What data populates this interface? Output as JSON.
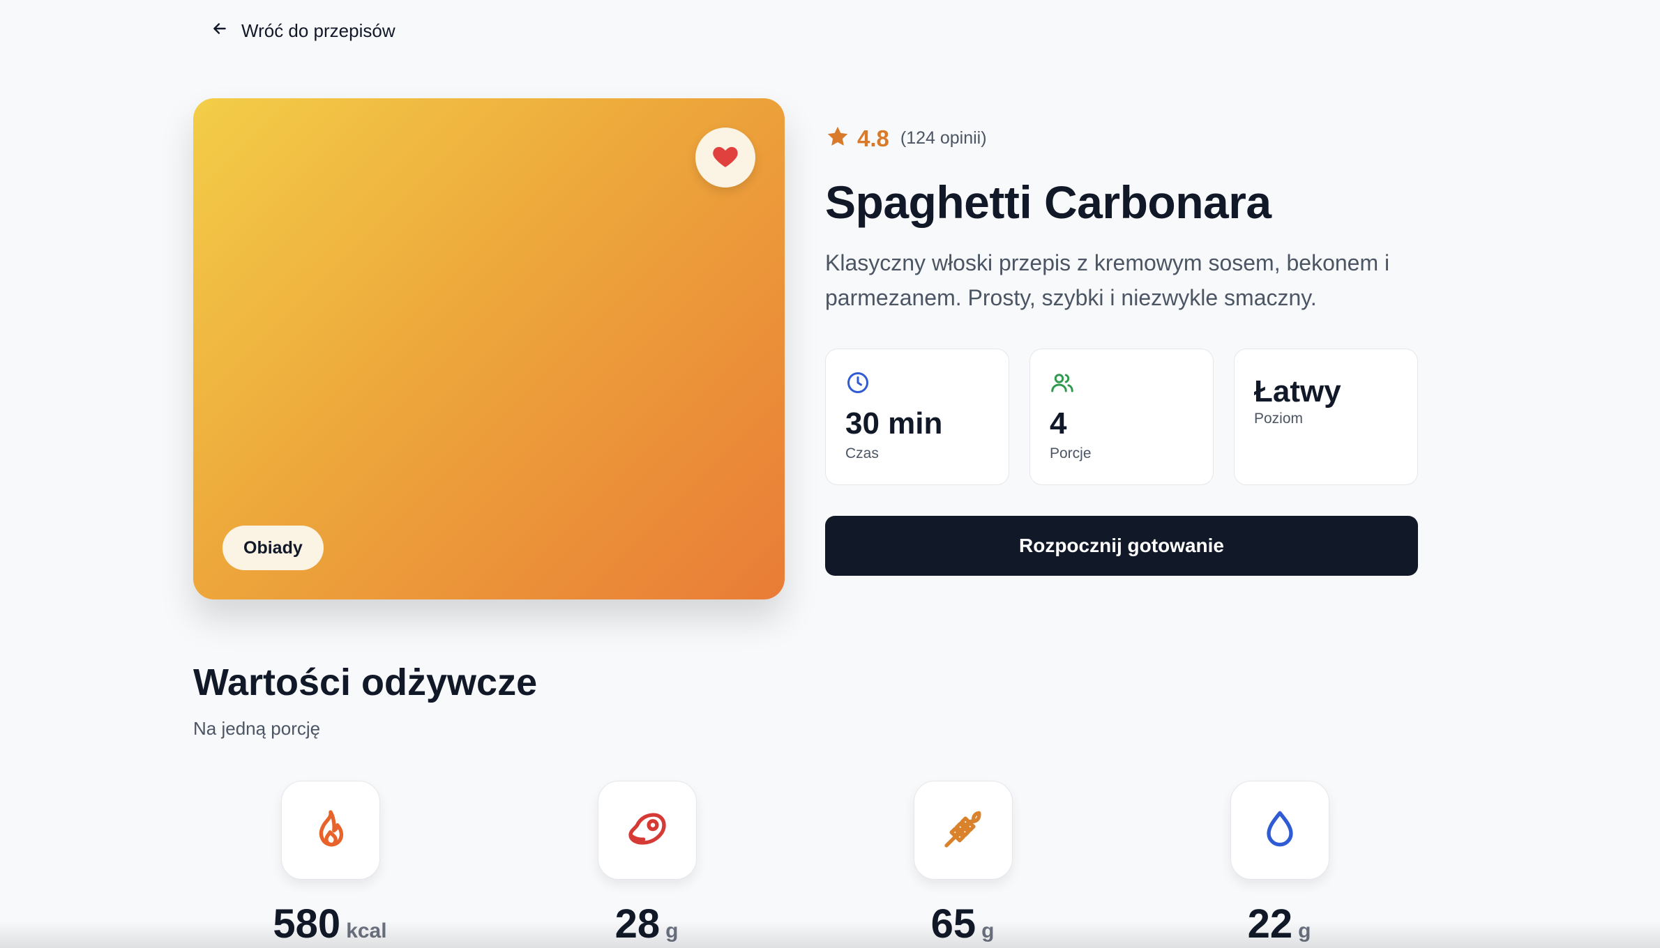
{
  "nav": {
    "back_label": "Wróć do przepisów"
  },
  "hero": {
    "category": "Obiady",
    "favorite": true,
    "gradient_colors": [
      "#f3cd48",
      "#eda73b",
      "#e97c37"
    ]
  },
  "recipe": {
    "rating": "4.8",
    "reviews": "(124 opinii)",
    "title": "Spaghetti Carbonara",
    "description": "Klasyczny włoski przepis z kremowym sosem, bekonem i parmezanem. Prosty, szybki i niezwykle smaczny."
  },
  "stats": [
    {
      "icon": "clock-icon",
      "value": "30 min",
      "label": "Czas",
      "color": "#2f5bd3"
    },
    {
      "icon": "users-icon",
      "value": "4",
      "label": "Porcje",
      "color": "#2f9a4e"
    },
    {
      "value": "Łatwy",
      "label": "Poziom"
    }
  ],
  "cta": {
    "label": "Rozpocznij gotowanie"
  },
  "nutrition": {
    "title": "Wartości odżywcze",
    "subtitle": "Na jedną porcję",
    "items": [
      {
        "icon": "flame-icon",
        "value": "580",
        "unit": "kcal",
        "color": "#e8632b"
      },
      {
        "icon": "steak-icon",
        "value": "28",
        "unit": "g",
        "color": "#d63a35"
      },
      {
        "icon": "wheat-icon",
        "value": "65",
        "unit": "g",
        "color": "#d9822b"
      },
      {
        "icon": "droplet-icon",
        "value": "22",
        "unit": "g",
        "color": "#2f5bd3"
      }
    ]
  },
  "colors": {
    "accent": "#d97a2a",
    "primary_button": "#111827",
    "heart": "#e0413f",
    "background": "#f8f9fb"
  }
}
